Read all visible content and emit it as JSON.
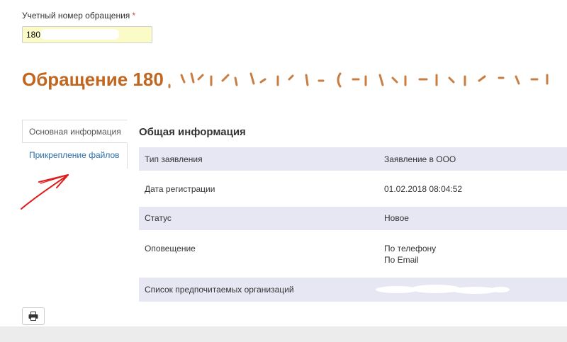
{
  "form": {
    "account_number_label": "Учетный номер обращения",
    "required_mark": "*",
    "account_number_value": "180"
  },
  "page_title": "Обращение 180",
  "tabs": [
    {
      "label": "Основная информация",
      "active": true
    },
    {
      "label": "Прикрепление файлов",
      "active": false
    }
  ],
  "section_title": "Общая информация",
  "details": [
    {
      "label": "Тип заявления",
      "values": [
        "Заявление в ООО"
      ]
    },
    {
      "label": "Дата регистрации",
      "values": [
        "01.02.2018 08:04:52"
      ]
    },
    {
      "label": "Статус",
      "values": [
        "Новое"
      ]
    },
    {
      "label": "Оповещение",
      "values": [
        "По телефону",
        "По Email"
      ]
    },
    {
      "label": "Список предпочитаемых организаций",
      "values": []
    }
  ],
  "toolbar": {
    "print_icon": "printer-icon"
  },
  "colors": {
    "title": "#c1661e",
    "link": "#2a70ac",
    "row_stripe": "#e7e7f4",
    "input_bg": "#fbfbc8",
    "required": "#d43f3a",
    "annotation_arrow": "#e01b1b"
  }
}
